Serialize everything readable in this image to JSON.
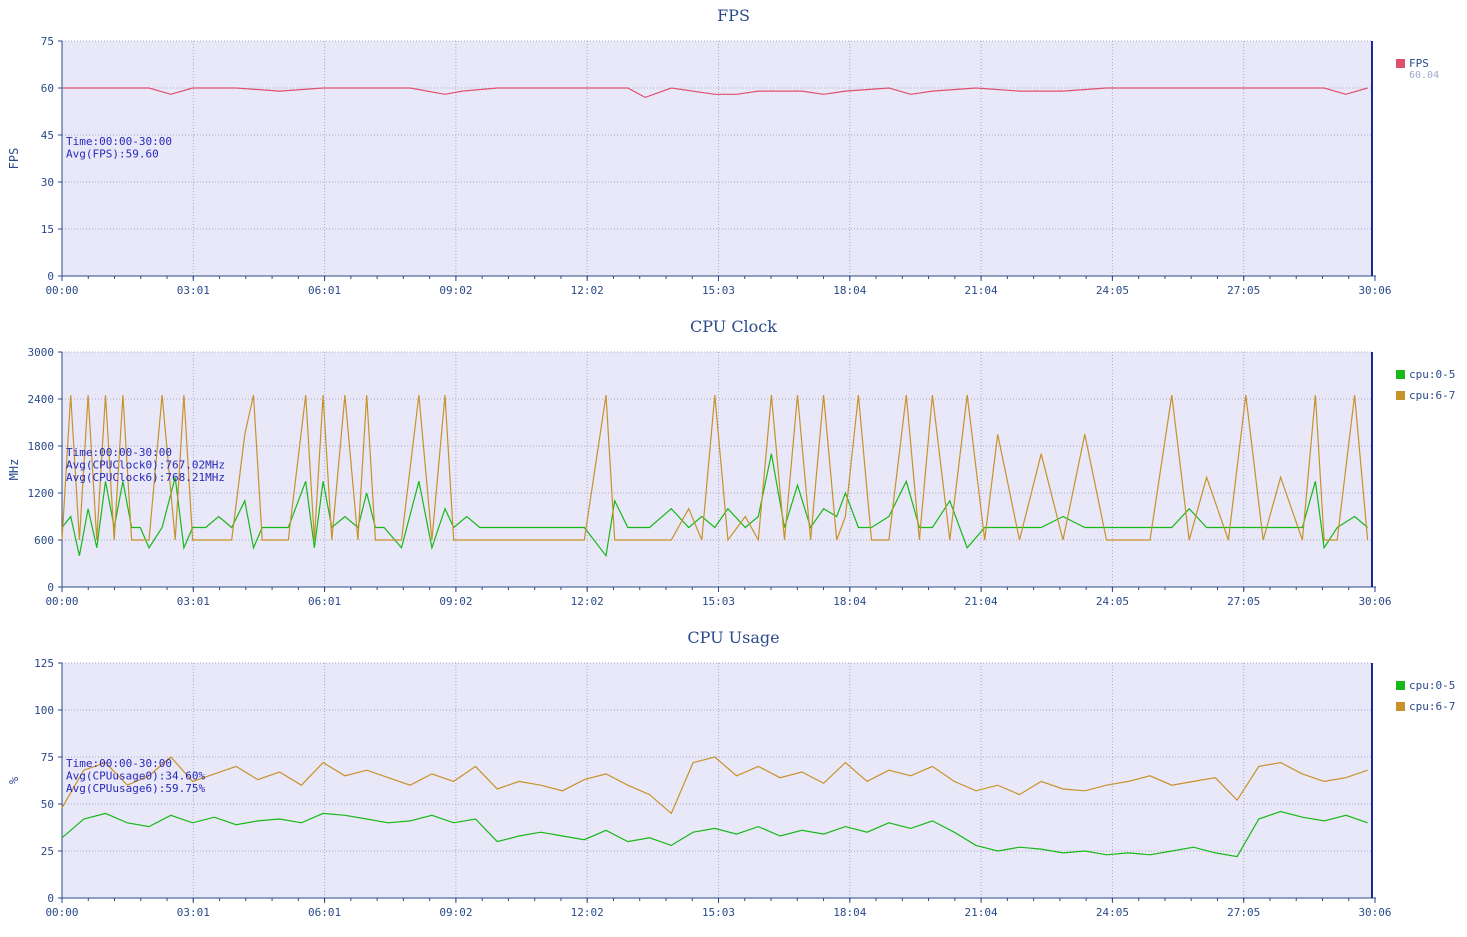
{
  "colors": {
    "fps": "#e0506e",
    "cpu05": "#18b818",
    "cpu67": "#c8922a",
    "plotBg": "#e8e8f8",
    "axis": "#2a4a8a",
    "grid": "#a8a8c8"
  },
  "x_tick_labels": [
    "00:00",
    "03:01",
    "06:01",
    "09:02",
    "12:02",
    "15:03",
    "18:04",
    "21:04",
    "24:05",
    "27:05",
    "30:06"
  ],
  "charts": [
    {
      "id": "fps",
      "title": "FPS",
      "ylabel": "FPS",
      "annotations": [
        "Time:00:00-30:00",
        "Avg(FPS):59.60"
      ],
      "legend": [
        {
          "label": "FPS",
          "sub": "60.04",
          "color": "#e0506e"
        }
      ]
    },
    {
      "id": "clock",
      "title": "CPU Clock",
      "ylabel": "MHz",
      "annotations": [
        "Time:00:00-30:00",
        "Avg(CPUClock0):767.02MHz",
        "Avg(CPUClock6):768.21MHz"
      ],
      "legend": [
        {
          "label": "cpu:0-5",
          "color": "#18b818"
        },
        {
          "label": "cpu:6-7",
          "color": "#c8922a"
        }
      ]
    },
    {
      "id": "usage",
      "title": "CPU Usage",
      "ylabel": "%",
      "annotations": [
        "Time:00:00-30:00",
        "Avg(CPUusage0):34.60%",
        "Avg(CPUusage6):59.75%"
      ],
      "legend": [
        {
          "label": "cpu:0-5",
          "color": "#18b818"
        },
        {
          "label": "cpu:6-7",
          "color": "#c8922a"
        }
      ]
    }
  ],
  "chart_data": [
    {
      "type": "line",
      "title": "FPS",
      "ylabel": "FPS",
      "xlim": [
        0,
        30.1
      ],
      "ylim": [
        0,
        75
      ],
      "yticks": [
        0,
        15,
        30,
        45,
        60,
        75
      ],
      "grid": true,
      "legend_position": "right",
      "x": [
        0,
        1,
        2,
        2.5,
        3,
        4,
        5,
        6,
        7,
        8,
        8.8,
        9.2,
        10,
        11,
        12,
        13,
        13.4,
        14,
        15,
        15.5,
        16,
        17,
        17.5,
        18,
        19,
        19.5,
        20,
        21,
        22,
        23,
        24,
        25,
        26,
        27,
        28,
        29,
        29.5,
        30
      ],
      "series": [
        {
          "name": "FPS",
          "values": [
            60,
            60,
            60,
            58,
            60,
            60,
            59,
            60,
            60,
            60,
            58,
            59,
            60,
            60,
            60,
            60,
            57,
            60,
            58,
            58,
            59,
            59,
            58,
            59,
            60,
            58,
            59,
            60,
            59,
            59,
            60,
            60,
            60,
            60,
            60,
            60,
            58,
            60
          ]
        }
      ]
    },
    {
      "type": "line",
      "title": "CPU Clock",
      "ylabel": "MHz",
      "xlim": [
        0,
        30.1
      ],
      "ylim": [
        0,
        3000
      ],
      "yticks": [
        0,
        600,
        1200,
        1800,
        2400,
        3000
      ],
      "grid": true,
      "legend_position": "right",
      "x": [
        0,
        0.2,
        0.4,
        0.6,
        0.8,
        1.0,
        1.2,
        1.4,
        1.6,
        1.8,
        2.0,
        2.3,
        2.6,
        2.8,
        3.0,
        3.3,
        3.6,
        3.9,
        4.2,
        4.4,
        4.6,
        4.9,
        5.2,
        5.6,
        5.8,
        6.0,
        6.2,
        6.5,
        6.8,
        7.0,
        7.2,
        7.4,
        7.8,
        8.2,
        8.5,
        8.8,
        9.0,
        9.3,
        9.6,
        10.0,
        10.5,
        11.0,
        11.5,
        12.0,
        12.5,
        12.7,
        13.0,
        13.5,
        14.0,
        14.4,
        14.7,
        15.0,
        15.3,
        15.7,
        16.0,
        16.3,
        16.6,
        16.9,
        17.2,
        17.5,
        17.8,
        18.0,
        18.3,
        18.6,
        19.0,
        19.4,
        19.7,
        20.0,
        20.4,
        20.8,
        21.2,
        21.5,
        22.0,
        22.5,
        23.0,
        23.5,
        24.0,
        24.5,
        25.0,
        25.5,
        25.9,
        26.3,
        26.8,
        27.2,
        27.6,
        28.0,
        28.5,
        28.8,
        29.0,
        29.3,
        29.7,
        30.0
      ],
      "series": [
        {
          "name": "cpu:0-5",
          "values": [
            760,
            900,
            400,
            1000,
            500,
            1350,
            760,
            1350,
            760,
            760,
            500,
            760,
            1400,
            500,
            760,
            760,
            900,
            760,
            1100,
            500,
            760,
            760,
            760,
            1350,
            500,
            1350,
            760,
            900,
            760,
            1200,
            760,
            760,
            500,
            1350,
            500,
            1000,
            760,
            900,
            760,
            760,
            760,
            760,
            760,
            760,
            400,
            1100,
            760,
            760,
            1000,
            760,
            900,
            760,
            1000,
            760,
            900,
            1700,
            760,
            1300,
            760,
            1000,
            900,
            1200,
            760,
            760,
            900,
            1350,
            760,
            760,
            1100,
            500,
            760,
            760,
            760,
            760,
            900,
            760,
            760,
            760,
            760,
            760,
            1000,
            760,
            760,
            760,
            760,
            760,
            760,
            1350,
            500,
            760,
            900,
            760
          ]
        },
        {
          "name": "cpu:6-7",
          "values": [
            600,
            2450,
            600,
            2450,
            600,
            2450,
            600,
            2450,
            600,
            600,
            600,
            2450,
            600,
            2450,
            600,
            600,
            600,
            600,
            1950,
            2450,
            600,
            600,
            600,
            2450,
            600,
            2450,
            600,
            2450,
            600,
            2450,
            600,
            600,
            600,
            2450,
            600,
            2450,
            600,
            600,
            600,
            600,
            600,
            600,
            600,
            600,
            2450,
            600,
            600,
            600,
            600,
            1000,
            600,
            2450,
            600,
            900,
            600,
            2450,
            600,
            2450,
            600,
            2450,
            600,
            900,
            2450,
            600,
            600,
            2450,
            600,
            2450,
            600,
            2450,
            600,
            1950,
            600,
            1700,
            600,
            1950,
            600,
            600,
            600,
            2450,
            600,
            1400,
            600,
            2450,
            600,
            1400,
            600,
            2450,
            600,
            600,
            2450,
            600
          ]
        }
      ]
    },
    {
      "type": "line",
      "title": "CPU Usage",
      "ylabel": "%",
      "xlim": [
        0,
        30.1
      ],
      "ylim": [
        0,
        125
      ],
      "yticks": [
        0,
        25,
        50,
        75,
        100,
        125
      ],
      "grid": true,
      "legend_position": "right",
      "x": [
        0,
        0.5,
        1,
        1.5,
        2,
        2.5,
        3,
        3.5,
        4,
        4.5,
        5,
        5.5,
        6,
        6.5,
        7,
        7.5,
        8,
        8.5,
        9,
        9.5,
        10,
        10.5,
        11,
        11.5,
        12,
        12.5,
        13,
        13.5,
        14,
        14.5,
        15,
        15.5,
        16,
        16.5,
        17,
        17.5,
        18,
        18.5,
        19,
        19.5,
        20,
        20.5,
        21,
        21.5,
        22,
        22.5,
        23,
        23.5,
        24,
        24.5,
        25,
        25.5,
        26,
        26.5,
        27,
        27.5,
        28,
        28.5,
        29,
        29.5,
        30
      ],
      "series": [
        {
          "name": "cpu:0-5",
          "values": [
            32,
            42,
            45,
            40,
            38,
            44,
            40,
            43,
            39,
            41,
            42,
            40,
            45,
            44,
            42,
            40,
            41,
            44,
            40,
            42,
            30,
            33,
            35,
            33,
            31,
            36,
            30,
            32,
            28,
            35,
            37,
            34,
            38,
            33,
            36,
            34,
            38,
            35,
            40,
            37,
            41,
            35,
            28,
            25,
            27,
            26,
            24,
            25,
            23,
            24,
            23,
            25,
            27,
            24,
            22,
            42,
            46,
            43,
            41,
            44,
            40
          ]
        },
        {
          "name": "cpu:6-7",
          "values": [
            48,
            68,
            72,
            60,
            65,
            75,
            62,
            66,
            70,
            63,
            67,
            60,
            72,
            65,
            68,
            64,
            60,
            66,
            62,
            70,
            58,
            62,
            60,
            57,
            63,
            66,
            60,
            55,
            45,
            72,
            75,
            65,
            70,
            64,
            67,
            61,
            72,
            62,
            68,
            65,
            70,
            62,
            57,
            60,
            55,
            62,
            58,
            57,
            60,
            62,
            65,
            60,
            62,
            64,
            52,
            70,
            72,
            66,
            62,
            64,
            68
          ]
        }
      ]
    }
  ]
}
